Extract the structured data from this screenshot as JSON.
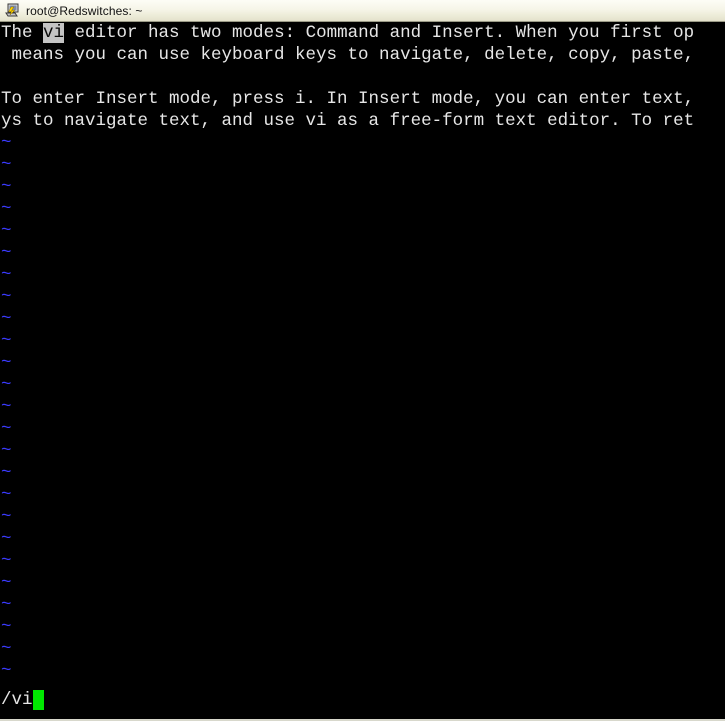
{
  "window": {
    "title": "root@Redswitches: ~",
    "icon": "putty-terminal-icon",
    "background_color": "#000000",
    "titlebar_color": "#f2f0e2"
  },
  "terminal": {
    "foreground_color": "#e6e6e6",
    "tilde_color": "#3b3bff",
    "highlight_background": "#c4c4c4",
    "highlight_foreground": "#0a0a0a",
    "cursor_color": "#00e800",
    "lines": [
      {
        "id": "buffer-line-1",
        "segments": [
          {
            "text": "The ",
            "style": "normal"
          },
          {
            "text": "vi",
            "style": "highlight"
          },
          {
            "text": " editor has two modes: Command and Insert. When you first op",
            "style": "normal"
          }
        ]
      },
      {
        "id": "buffer-line-2",
        "segments": [
          {
            "text": " means you can use keyboard keys to navigate, delete, copy, paste,",
            "style": "normal"
          }
        ]
      },
      {
        "id": "buffer-line-3",
        "segments": [
          {
            "text": "",
            "style": "normal"
          }
        ]
      },
      {
        "id": "buffer-line-4",
        "segments": [
          {
            "text": "To enter Insert mode, press i. In Insert mode, you can enter text,",
            "style": "normal"
          }
        ]
      },
      {
        "id": "buffer-line-5",
        "segments": [
          {
            "text": "ys to navigate text, and use vi as a free-form text editor. To ret",
            "style": "normal"
          }
        ]
      }
    ],
    "empty_line_marker": "~",
    "empty_line_count": 25,
    "command_line": {
      "prompt": "/",
      "value": "vi",
      "cursor": "block-cursor"
    }
  }
}
